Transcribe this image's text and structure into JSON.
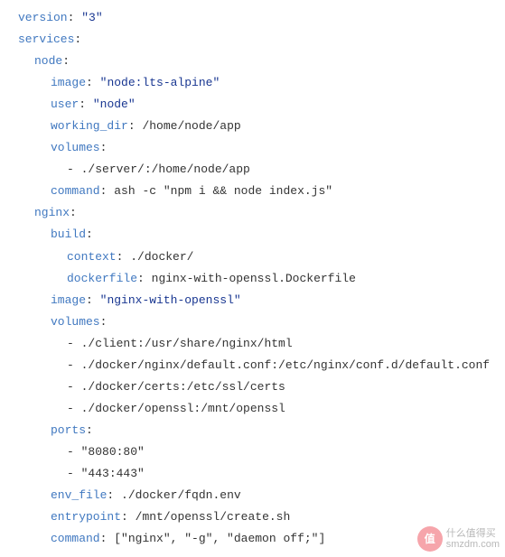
{
  "lines": [
    {
      "indent": 0,
      "type": "kv",
      "key": "version",
      "value": "\"3\"",
      "quoted": true
    },
    {
      "indent": 0,
      "type": "kv",
      "key": "services",
      "value": "",
      "quoted": false
    },
    {
      "indent": 1,
      "type": "kv",
      "key": "node",
      "value": "",
      "quoted": false
    },
    {
      "indent": 2,
      "type": "kv",
      "key": "image",
      "value": "\"node:lts-alpine\"",
      "quoted": true
    },
    {
      "indent": 2,
      "type": "kv",
      "key": "user",
      "value": "\"node\"",
      "quoted": true
    },
    {
      "indent": 2,
      "type": "kv",
      "key": "working_dir",
      "value": "/home/node/app",
      "quoted": false
    },
    {
      "indent": 2,
      "type": "kv",
      "key": "volumes",
      "value": "",
      "quoted": false
    },
    {
      "indent": 3,
      "type": "item",
      "value": "./server/:/home/node/app"
    },
    {
      "indent": 2,
      "type": "kv",
      "key": "command",
      "value": "ash -c \"npm i && node index.js\"",
      "quoted": false
    },
    {
      "indent": 1,
      "type": "kv",
      "key": "nginx",
      "value": "",
      "quoted": false
    },
    {
      "indent": 2,
      "type": "kv",
      "key": "build",
      "value": "",
      "quoted": false
    },
    {
      "indent": 3,
      "type": "kv",
      "key": "context",
      "value": "./docker/",
      "quoted": false
    },
    {
      "indent": 3,
      "type": "kv",
      "key": "dockerfile",
      "value": "nginx-with-openssl.Dockerfile",
      "quoted": false
    },
    {
      "indent": 2,
      "type": "kv",
      "key": "image",
      "value": "\"nginx-with-openssl\"",
      "quoted": true
    },
    {
      "indent": 2,
      "type": "kv",
      "key": "volumes",
      "value": "",
      "quoted": false
    },
    {
      "indent": 3,
      "type": "item",
      "value": "./client:/usr/share/nginx/html"
    },
    {
      "indent": 3,
      "type": "item",
      "value": "./docker/nginx/default.conf:/etc/nginx/conf.d/default.conf"
    },
    {
      "indent": 3,
      "type": "item",
      "value": "./docker/certs:/etc/ssl/certs"
    },
    {
      "indent": 3,
      "type": "item",
      "value": "./docker/openssl:/mnt/openssl"
    },
    {
      "indent": 2,
      "type": "kv",
      "key": "ports",
      "value": "",
      "quoted": false
    },
    {
      "indent": 3,
      "type": "item",
      "value": "\"8080:80\""
    },
    {
      "indent": 3,
      "type": "item",
      "value": "\"443:443\""
    },
    {
      "indent": 2,
      "type": "kv",
      "key": "env_file",
      "value": "./docker/fqdn.env",
      "quoted": false
    },
    {
      "indent": 2,
      "type": "kv",
      "key": "entrypoint",
      "value": "/mnt/openssl/create.sh",
      "quoted": false
    },
    {
      "indent": 2,
      "type": "kv",
      "key": "command",
      "value": "[\"nginx\", \"-g\", \"daemon off;\"]",
      "quoted": false
    }
  ],
  "watermark": {
    "badge": "值",
    "line1": "什么值得买",
    "line2": "smzdm.com"
  }
}
